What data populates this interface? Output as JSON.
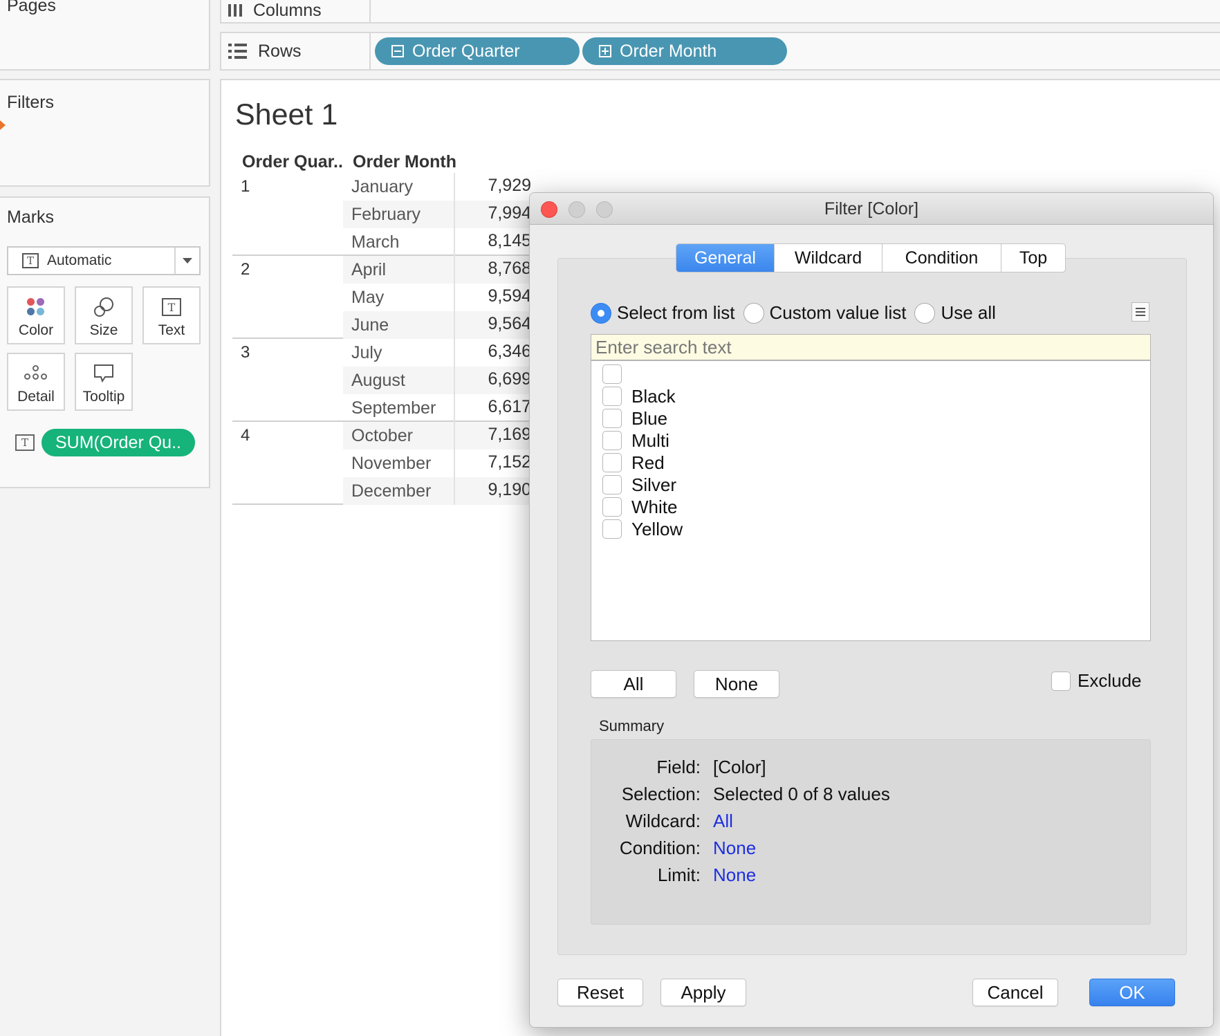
{
  "left_panel": {
    "pages": {
      "title": "Pages"
    },
    "filters": {
      "title": "Filters"
    },
    "marks": {
      "title": "Marks",
      "mark_type": "Automatic",
      "buttons": [
        {
          "label": "Color",
          "icon": "color-dots-icon"
        },
        {
          "label": "Size",
          "icon": "size-icon"
        },
        {
          "label": "Text",
          "icon": "text-icon"
        },
        {
          "label": "Detail",
          "icon": "detail-dots-icon"
        },
        {
          "label": "Tooltip",
          "icon": "tooltip-icon"
        }
      ],
      "pill": {
        "label": "SUM(Order Qu..",
        "icon": "text-icon"
      }
    }
  },
  "shelves": {
    "columns": {
      "label": "Columns"
    },
    "rows": {
      "label": "Rows",
      "pills": [
        "Order Quarter",
        "Order Month"
      ]
    }
  },
  "sheet": {
    "title": "Sheet 1",
    "headers": [
      "Order Quar..",
      "Order Month"
    ],
    "groups": [
      {
        "quarter": "1",
        "months": [
          {
            "name": "January",
            "value": "7,929"
          },
          {
            "name": "February",
            "value": "7,994"
          },
          {
            "name": "March",
            "value": "8,145"
          }
        ]
      },
      {
        "quarter": "2",
        "months": [
          {
            "name": "April",
            "value": "8,768"
          },
          {
            "name": "May",
            "value": "9,594"
          },
          {
            "name": "June",
            "value": "9,564"
          }
        ]
      },
      {
        "quarter": "3",
        "months": [
          {
            "name": "July",
            "value": "6,346"
          },
          {
            "name": "August",
            "value": "6,699"
          },
          {
            "name": "September",
            "value": "6,617"
          }
        ]
      },
      {
        "quarter": "4",
        "months": [
          {
            "name": "October",
            "value": "7,169"
          },
          {
            "name": "November",
            "value": "7,152"
          },
          {
            "name": "December",
            "value": "9,190"
          }
        ]
      }
    ]
  },
  "dialog": {
    "title": "Filter [Color]",
    "tabs": [
      "General",
      "Wildcard",
      "Condition",
      "Top"
    ],
    "active_tab": "General",
    "radios": [
      {
        "label": "Select from list",
        "checked": true
      },
      {
        "label": "Custom value list",
        "checked": false
      },
      {
        "label": "Use all",
        "checked": false
      }
    ],
    "search_placeholder": "Enter search text",
    "list_items": [
      "",
      "Black",
      "Blue",
      "Multi",
      "Red",
      "Silver",
      "White",
      "Yellow"
    ],
    "all_label": "All",
    "none_label": "None",
    "exclude_label": "Exclude",
    "summary_title": "Summary",
    "summary": {
      "field_key": "Field:",
      "field_val": "[Color]",
      "selection_key": "Selection:",
      "selection_val": "Selected 0 of 8 values",
      "wildcard_key": "Wildcard:",
      "wildcard_val": "All",
      "condition_key": "Condition:",
      "condition_val": "None",
      "limit_key": "Limit:",
      "limit_val": "None"
    },
    "reset_label": "Reset",
    "apply_label": "Apply",
    "cancel_label": "Cancel",
    "ok_label": "OK",
    "link_color": "#1d2ee0",
    "accent_color": "#3b86ed"
  }
}
